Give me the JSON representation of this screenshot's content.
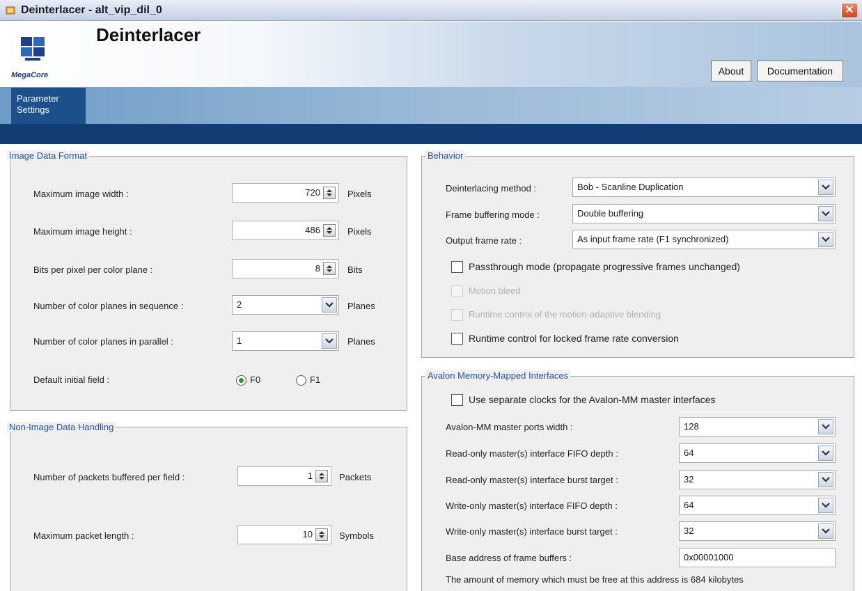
{
  "window": {
    "title": "Deinterlacer - alt_vip_dil_0",
    "close_label": "✕"
  },
  "header": {
    "heading": "Deinterlacer",
    "logo_text": "MegaCore",
    "buttons": {
      "about": "About",
      "documentation": "Documentation"
    }
  },
  "tabs": {
    "active_line1": "Parameter",
    "active_line2": "Settings"
  },
  "image_data_format": {
    "legend": "Image Data Format",
    "max_width": {
      "label": "Maximum image width :",
      "value": "720",
      "unit": "Pixels"
    },
    "max_height": {
      "label": "Maximum image height :",
      "value": "486",
      "unit": "Pixels"
    },
    "bits_per_pixel": {
      "label": "Bits per pixel per color plane :",
      "value": "8",
      "unit": "Bits"
    },
    "planes_sequence": {
      "label": "Number of color planes in sequence :",
      "value": "2",
      "unit": "Planes"
    },
    "planes_parallel": {
      "label": "Number of color planes in parallel :",
      "value": "1",
      "unit": "Planes"
    },
    "initial_field": {
      "label": "Default initial field :",
      "option1": "F0",
      "option2": "F1",
      "selected": "F0"
    }
  },
  "non_image_data": {
    "legend": "Non-Image Data Handling",
    "packets_per_field": {
      "label": "Number of packets buffered per field :",
      "value": "1",
      "unit": "Packets"
    },
    "max_packet_length": {
      "label": "Maximum packet length :",
      "value": "10",
      "unit": "Symbols"
    }
  },
  "behavior": {
    "legend": "Behavior",
    "deinterlacing_method": {
      "label": "Deinterlacing method :",
      "value": "Bob - Scanline Duplication"
    },
    "frame_buffering": {
      "label": "Frame buffering mode :",
      "value": "Double buffering"
    },
    "output_frame_rate": {
      "label": "Output frame rate :",
      "value": "As input frame rate (F1 synchronized)"
    },
    "passthrough": "Passthrough mode (propagate progressive frames unchanged)",
    "motion_bleed": "Motion bleed",
    "runtime_blending": "Runtime control of the motion-adaptive blending",
    "runtime_locked": "Runtime control for locked frame rate conversion"
  },
  "avalon_mm": {
    "legend": "Avalon Memory-Mapped Interfaces",
    "separate_clocks": "Use separate clocks for the Avalon-MM master interfaces",
    "ports_width": {
      "label": "Avalon-MM master ports width :",
      "value": "128"
    },
    "read_fifo": {
      "label": "Read-only master(s) interface FIFO depth :",
      "value": "64"
    },
    "read_burst": {
      "label": "Read-only master(s) interface burst target :",
      "value": "32"
    },
    "write_fifo": {
      "label": "Write-only master(s) interface FIFO depth :",
      "value": "64"
    },
    "write_burst": {
      "label": "Write-only master(s) interface burst target :",
      "value": "32"
    },
    "base_address": {
      "label": "Base address of frame buffers :",
      "value": "0x00001000"
    },
    "memory_note": "The amount of memory which must be free at this address is 684 kilobytes"
  },
  "colors": {
    "legend": "#1f55a6",
    "tab_active": "#1d4f8a",
    "nav_bar": "#123d74",
    "radio_selected": "#2e9a2e"
  }
}
